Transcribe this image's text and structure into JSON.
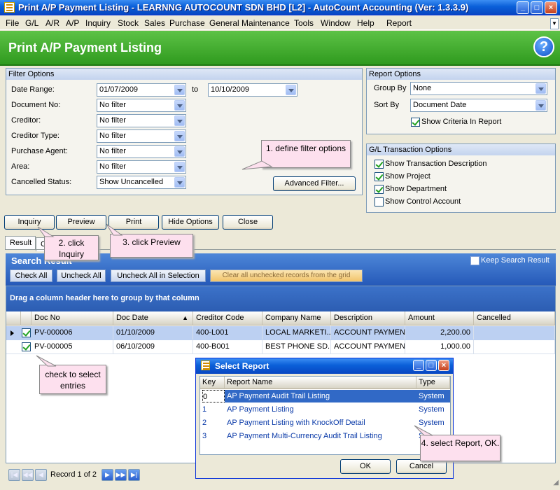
{
  "window": {
    "title": "Print A/P Payment Listing - LEARNNG AUTOCOUNT SDN BHD [L2] - AutoCount Accounting (Ver: 1.3.3.9)",
    "min_icon": "minimize-icon",
    "max_icon": "maximize-icon",
    "close_icon": "close-icon"
  },
  "menu": [
    "File",
    "G/L",
    "A/R",
    "A/P",
    "Inquiry",
    "Stock",
    "Sales",
    "Purchase",
    "General Maintenance",
    "Tools",
    "Window",
    "Help",
    "Report"
  ],
  "banner": {
    "title": "Print A/P Payment Listing",
    "help": "?"
  },
  "filter": {
    "title": "Filter Options",
    "date_range_label": "Date Range:",
    "date_from": "01/07/2009",
    "date_to_label": "to",
    "date_to": "10/10/2009",
    "document_no_label": "Document No:",
    "document_no": "No filter",
    "creditor_label": "Creditor:",
    "creditor": "No filter",
    "creditor_type_label": "Creditor Type:",
    "creditor_type": "No filter",
    "purchase_agent_label": "Purchase Agent:",
    "purchase_agent": "No filter",
    "area_label": "Area:",
    "area": "No filter",
    "cancelled_label": "Cancelled Status:",
    "cancelled": "Show Uncancelled",
    "advanced": "Advanced Filter..."
  },
  "report_options": {
    "title": "Report Options",
    "group_by_label": "Group By",
    "group_by": "None",
    "sort_by_label": "Sort By",
    "sort_by": "Document Date",
    "show_criteria": "Show Criteria In Report"
  },
  "gl_options": {
    "title": "G/L Transaction Options",
    "items": [
      {
        "label": "Show Transaction Description",
        "checked": true
      },
      {
        "label": "Show Project",
        "checked": true
      },
      {
        "label": "Show Department",
        "checked": true
      },
      {
        "label": "Show Control Account",
        "checked": false
      }
    ]
  },
  "actions": {
    "inquiry": "Inquiry",
    "preview": "Preview",
    "print": "Print",
    "hide_options": "Hide Options",
    "close": "Close"
  },
  "tabs": {
    "result": "Result",
    "criteria": "C"
  },
  "search": {
    "title": "Search Result",
    "keep": "Keep Search Result",
    "check_all": "Check All",
    "uncheck_all": "Uncheck All",
    "uncheck_selection": "Uncheck All in Selection",
    "clear_unchecked": "Clear all unchecked records from the grid"
  },
  "grid": {
    "group_hint": "Drag a column header here to group by that column",
    "columns": [
      "Doc No",
      "Doc Date",
      "Creditor Code",
      "Company Name",
      "Description",
      "Amount",
      "Cancelled"
    ],
    "rows": [
      [
        "PV-000006",
        "01/10/2009",
        "400-L001",
        "LOCAL MARKETI...",
        "ACCOUNT PAYMENT",
        "2,200.00",
        ""
      ],
      [
        "PV-000005",
        "06/10/2009",
        "400-B001",
        "BEST PHONE SD...",
        "ACCOUNT PAYMENT",
        "1,000.00",
        ""
      ]
    ]
  },
  "nav": {
    "record": "Record 1 of 2"
  },
  "dialog": {
    "title": "Select Report",
    "columns": [
      "Key",
      "Report Name",
      "Type"
    ],
    "rows": [
      [
        "0",
        "AP Payment Audit Trail Listing",
        "System"
      ],
      [
        "1",
        "AP Payment Listing",
        "System"
      ],
      [
        "2",
        "AP Payment Listing with KnockOff Detail",
        "System"
      ],
      [
        "3",
        "AP Payment Multi-Currency Audit Trail Listing",
        "Sys"
      ]
    ],
    "ok": "OK",
    "cancel": "Cancel"
  },
  "callouts": {
    "c1": "1. define filter options",
    "c2": "2. click Inquiry",
    "c3": "3. click Preview",
    "c4": "check to select entries",
    "c5": "4. select Report, OK."
  }
}
